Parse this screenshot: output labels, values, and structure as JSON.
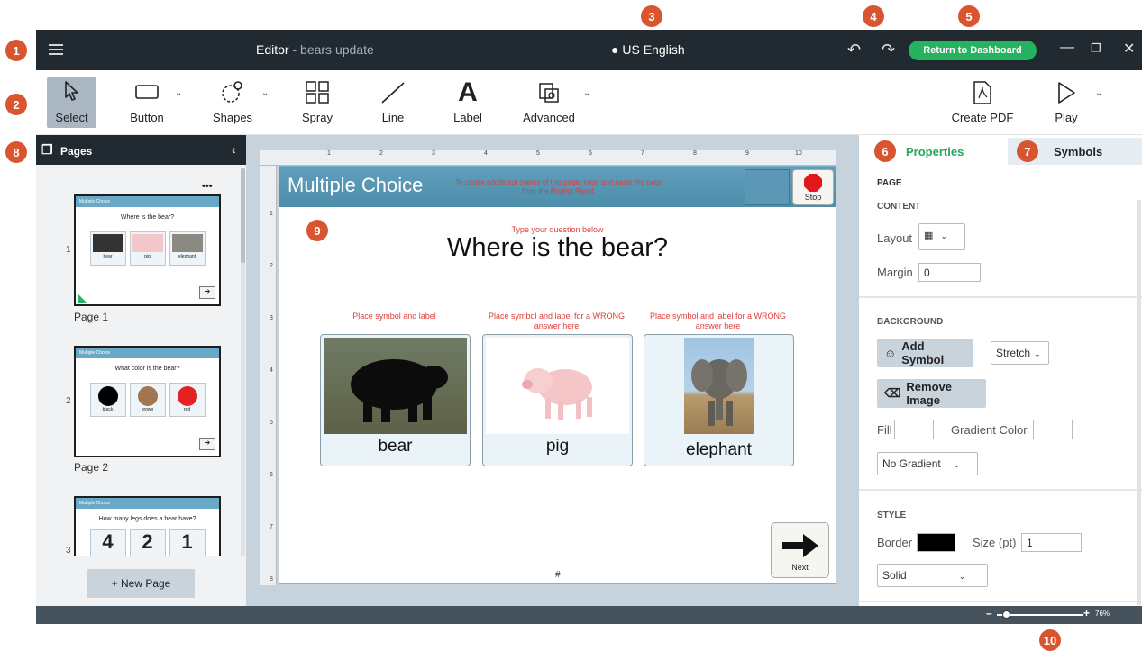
{
  "callouts": [
    "1",
    "2",
    "3",
    "4",
    "5",
    "6",
    "7",
    "8",
    "9",
    "10"
  ],
  "titlebar": {
    "editor_label": "Editor",
    "separator": "-",
    "project_name": "bears update",
    "language": "US English",
    "dashboard_button": "Return to Dashboard"
  },
  "toolbar": {
    "select": "Select",
    "button": "Button",
    "shapes": "Shapes",
    "spray": "Spray",
    "line": "Line",
    "label": "Label",
    "advanced": "Advanced",
    "create_pdf": "Create PDF",
    "play": "Play"
  },
  "pages_panel": {
    "title": "Pages",
    "pages": [
      {
        "number": "1",
        "label": "Page 1",
        "banner": "Multiple Choice",
        "question": "Where is the bear?",
        "cells": [
          "bear",
          "pig",
          "elephant"
        ]
      },
      {
        "number": "2",
        "label": "Page 2",
        "banner": "Multiple Choice",
        "question": "What color is the bear?",
        "cells": [
          "black",
          "brown",
          "red"
        ]
      },
      {
        "number": "3",
        "label": "",
        "banner": "Multiple Choice",
        "question": "How many legs does a bear have?",
        "cells": [
          "4",
          "2",
          "1"
        ]
      }
    ],
    "new_page": "+ New Page",
    "more": "•••"
  },
  "rulers": {
    "top": [
      "1",
      "2",
      "3",
      "4",
      "5",
      "6",
      "7",
      "8",
      "9",
      "10"
    ],
    "left": [
      "1",
      "2",
      "3",
      "4",
      "5",
      "6",
      "7",
      "8"
    ]
  },
  "canvas": {
    "banner_title": "Multiple Choice",
    "banner_hint": "To create additional copies of this page, copy and paste the page from the Project Panel.",
    "stop_label": "Stop",
    "question_hint": "Type your question below",
    "question": "Where is the bear?",
    "cards": [
      {
        "hint": "Place symbol and label",
        "name": "bear"
      },
      {
        "hint": "Place symbol and label for a WRONG answer here",
        "name": "pig"
      },
      {
        "hint": "Place symbol and label for a WRONG answer here",
        "name": "elephant"
      }
    ],
    "page_marker": "#",
    "next_label": "Next"
  },
  "properties": {
    "tab_properties": "Properties",
    "tab_symbols": "Symbols",
    "section_page": "PAGE",
    "section_content": "CONTENT",
    "layout_label": "Layout",
    "margin_label": "Margin",
    "margin_value": "0",
    "section_background": "BACKGROUND",
    "add_symbol": "Add Symbol",
    "stretch": "Stretch",
    "remove_image": "Remove Image",
    "fill_label": "Fill",
    "gradient_color_label": "Gradient Color",
    "gradient_select": "No Gradient",
    "section_style": "STYLE",
    "border_label": "Border",
    "size_label": "Size (pt)",
    "size_value": "1",
    "border_style": "Solid",
    "border_color": "#000000"
  },
  "statusbar": {
    "zoom": "76%",
    "zoom_fraction": 0.1
  },
  "colors": {
    "accent": "#25b35f",
    "titlebar": "#222a31",
    "callout": "#d9552f",
    "banner": "#5f9fbc",
    "hint_red": "#e23b3b"
  }
}
